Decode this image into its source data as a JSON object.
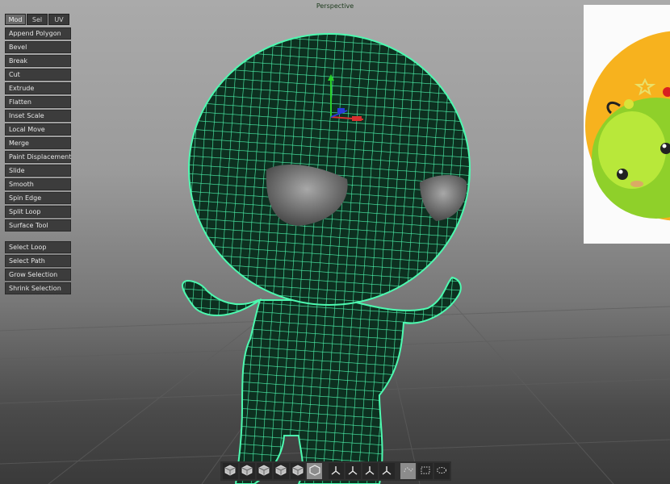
{
  "viewport": {
    "title": "Perspective"
  },
  "mode_tabs": [
    {
      "label": "Mod",
      "active": true
    },
    {
      "label": "Sel",
      "active": false
    },
    {
      "label": "UV",
      "active": false
    }
  ],
  "mod_tools": [
    "Append Polygon",
    "Bevel",
    "Break",
    "Cut",
    "Extrude",
    "Flatten",
    "Inset Scale",
    "Local Move",
    "Merge",
    "Paint Displacement",
    "Slide",
    "Smooth",
    "Spin Edge",
    "Split Loop",
    "Surface Tool"
  ],
  "select_tools": [
    "Select Loop",
    "Select Path",
    "Grow Selection",
    "Shrink Selection"
  ],
  "bottom_toolbar": [
    {
      "icon": "cube-vertex-icon"
    },
    {
      "icon": "cube-edge-icon"
    },
    {
      "icon": "cube-face-icon"
    },
    {
      "icon": "cube-object-icon"
    },
    {
      "icon": "cube-solid-icon"
    },
    {
      "icon": "cube-wire-icon",
      "active": true
    },
    {
      "icon": "axis-y-icon"
    },
    {
      "icon": "axis-xyz-icon"
    },
    {
      "icon": "axis-world-icon"
    },
    {
      "icon": "axis-local-icon"
    },
    {
      "icon": "lasso-icon",
      "active": true
    },
    {
      "icon": "marquee-rect-icon"
    },
    {
      "icon": "marquee-ellipse-icon"
    }
  ],
  "colors": {
    "wireframe": "#4dfab0",
    "viewport_top": "#aaaaaa",
    "viewport_bottom": "#3a3a3a",
    "toolbar": "#3c3c3c"
  },
  "reference_image": {
    "subject": "cartoon green pear character on orange circle"
  }
}
